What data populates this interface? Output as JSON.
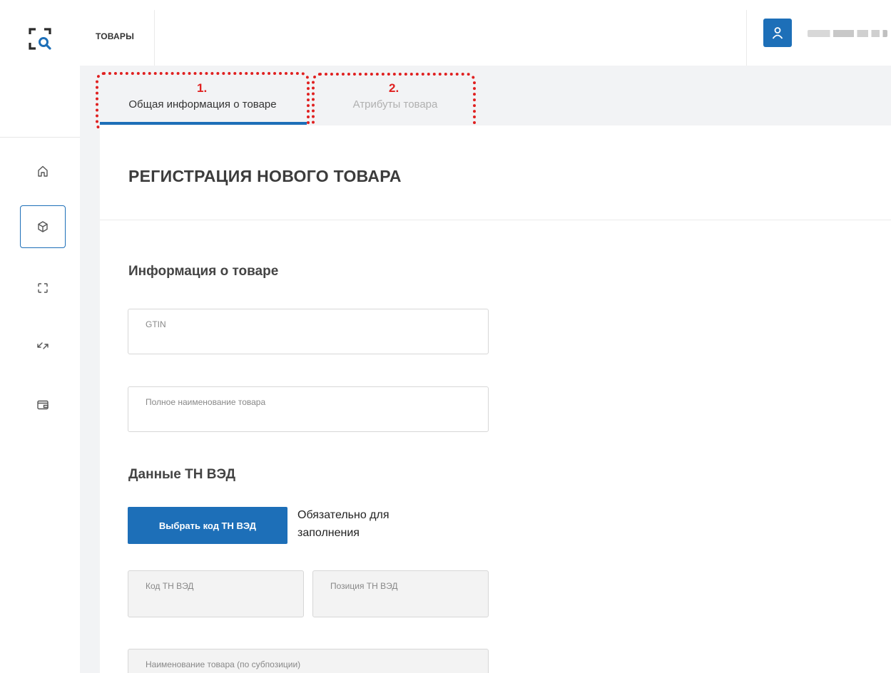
{
  "header": {
    "title": "ТОВАРЫ"
  },
  "sidebar": {
    "items": [
      {
        "name": "home-icon",
        "active": false
      },
      {
        "name": "box-icon",
        "active": true
      },
      {
        "name": "scan-icon",
        "active": false
      },
      {
        "name": "transfer-icon",
        "active": false
      },
      {
        "name": "wallet-icon",
        "active": false
      }
    ]
  },
  "tabs": [
    {
      "label": "Общая информация о товаре",
      "active": true
    },
    {
      "label": "Атрибуты товара",
      "active": false
    }
  ],
  "annotations": [
    "1.",
    "2."
  ],
  "form": {
    "title": "РЕГИСТРАЦИЯ НОВОГО ТОВАРА",
    "section_product": "Информация о товаре",
    "gtin_label": "GTIN",
    "full_name_label": "Полное наименование товара",
    "section_tnved": "Данные ТН ВЭД",
    "select_code_button": "Выбрать код ТН ВЭД",
    "required_note": "Обязательно для заполнения",
    "tnved_code_label": "Код ТН ВЭД",
    "tnved_position_label": "Позиция ТН ВЭД",
    "subposition_name_label": "Наименование товара (по субпозиции)"
  },
  "colors": {
    "accent": "#1d6fb8",
    "annotation": "#e02020"
  }
}
